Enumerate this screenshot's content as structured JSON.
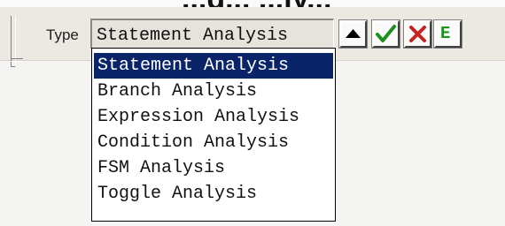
{
  "banner": {
    "clipped_text": "...g... ...ly..."
  },
  "toolbar": {
    "type_label": "Type",
    "type_value": "Statement Analysis",
    "buttons": {
      "collapse_icon": "triangle-up-icon",
      "accept_icon": "check-icon",
      "reject_icon": "x-icon",
      "edit_label": "E"
    }
  },
  "dropdown": {
    "options": [
      "Statement Analysis",
      "Branch Analysis",
      "Expression Analysis",
      "Condition Analysis",
      "FSM Analysis",
      "Toggle Analysis"
    ],
    "selected_index": 0
  },
  "colors": {
    "selection": "#0a246a",
    "check": "#1d8f1d",
    "cross": "#c62222"
  }
}
